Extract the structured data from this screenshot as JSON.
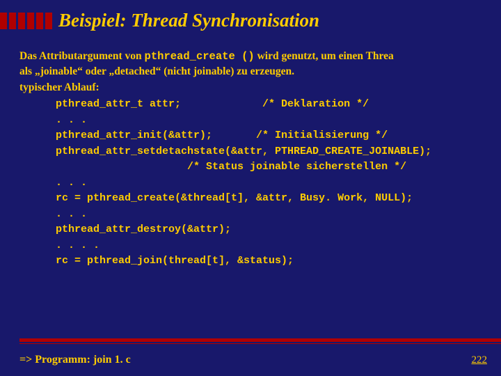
{
  "slide": {
    "title": "Beispiel: Thread Synchronisation",
    "intro_part1": "Das Attributargument von ",
    "intro_code": "pthread_create ()",
    "intro_part2": " wird genutzt, um einen Threa",
    "intro_line2": "als „joinable“ oder „detached“ (nicht joinable) zu erzeugen.",
    "intro_line3": "typischer Ablauf:",
    "code": "pthread_attr_t attr;             /* Deklaration */\n. . .\npthread_attr_init(&attr);       /* Initialisierung */\npthread_attr_setdetachstate(&attr, PTHREAD_CREATE_JOINABLE);\n                     /* Status joinable sicherstellen */\n. . .\nrc = pthread_create(&thread[t], &attr, Busy. Work, NULL);\n. . .\npthread_attr_destroy(&attr);\n. . . .\nrc = pthread_join(thread[t], &status);",
    "footer": "=> Programm: join 1. c",
    "page": "222"
  }
}
